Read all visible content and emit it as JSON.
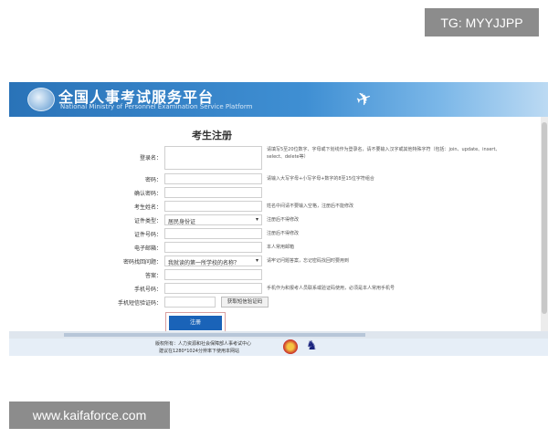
{
  "watermarks": {
    "top": "TG: MYYJJPP",
    "bottom": "www.kaifaforce.com"
  },
  "site": {
    "title": "全国人事考试服务平台",
    "subtitle": "National Ministry of Personnel Examination Service Platform"
  },
  "form": {
    "title": "考生注册",
    "rows": [
      {
        "label": "登录名：",
        "value": "",
        "hint": "请填写5至20位数字、字母或下划线作为登录名，请不要输入汉字或其他特殊字符（包括：join、update、insert、select、delete等）"
      },
      {
        "label": "密码：",
        "value": "",
        "hint": "请输入大写字母+小写字母+数字的8至15位字符组合"
      },
      {
        "label": "确认密码：",
        "value": "",
        "hint": ""
      },
      {
        "label": "考生姓名：",
        "value": "",
        "hint": "姓名中间请不要输入空格，注册后不能修改"
      },
      {
        "label": "证件类型：",
        "value": "居民身份证",
        "hint": "注册后不得修改"
      },
      {
        "label": "证件号码：",
        "value": "",
        "hint": "注册后不得修改"
      },
      {
        "label": "电子邮箱：",
        "value": "",
        "hint": "本人常用邮箱"
      },
      {
        "label": "密码找回问题：",
        "value": "我就读的第一所学校的名称？",
        "hint": "请牢记问题答案，忘记密码找回时要用到"
      },
      {
        "label": "答案：",
        "value": "",
        "hint": ""
      },
      {
        "label": "手机号码：",
        "value": "",
        "hint": "手机作为和报考人员联系或验证码使用，必须是本人常用手机号"
      },
      {
        "label": "手机短信验证码：",
        "value": "",
        "hint": ""
      }
    ],
    "get_code_button": "获取短信验证码",
    "submit_button": "注册"
  },
  "footer": {
    "line1": "版权所有：人力资源和社会保障部人事考试中心",
    "line2": "建议在1280*1024分辨率下使用本网站"
  },
  "icons": {
    "logo": "site-logo",
    "plane": "airplane-icon",
    "emblem": "national-emblem-icon",
    "badge": "police-badge-icon"
  },
  "colors": {
    "banner": "#2a73b8",
    "submit": "#1a63b8"
  }
}
